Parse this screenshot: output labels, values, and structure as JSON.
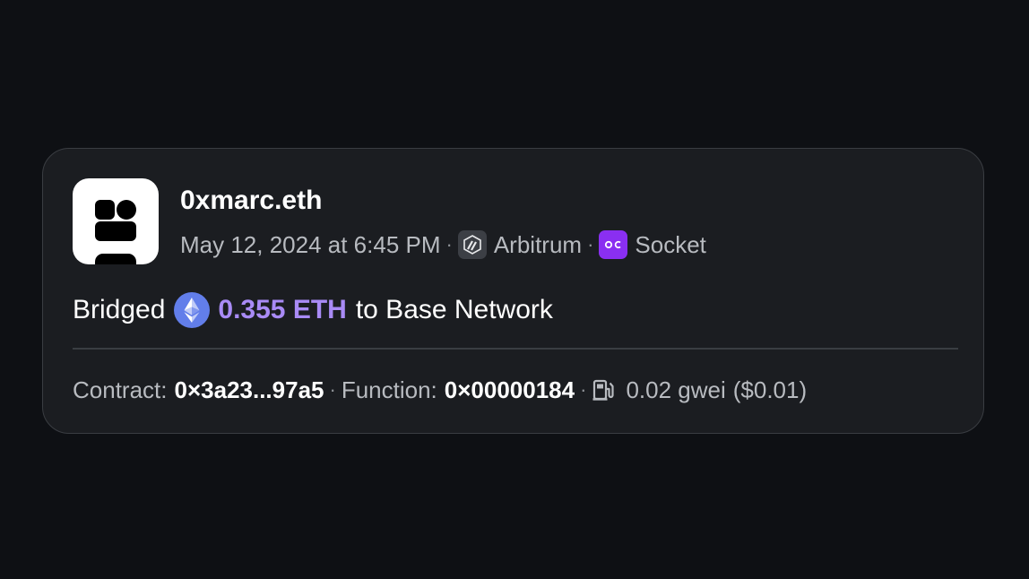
{
  "activity": {
    "user_name": "0xmarc.eth",
    "date": "May 12, 2024 at 6:45 PM",
    "chain": {
      "label": "Arbitrum",
      "icon": "arbitrum-icon"
    },
    "protocol": {
      "label": "Socket",
      "icon": "socket-icon",
      "color": "#8a2ff1"
    },
    "action": {
      "verb": "Bridged",
      "token_icon": "ethereum-icon",
      "amount": "0.355 ETH",
      "destination": "to Base Network",
      "amount_color": "#a98bf6"
    },
    "details": {
      "contract_label": "Contract:",
      "contract_value": "0×3a23...97a5",
      "function_label": "Function:",
      "function_value": "0×00000184",
      "gas_icon": "gas-pump-icon",
      "gas_amount": "0.02 gwei",
      "gas_usd": "($0.01)"
    },
    "separator": "·"
  }
}
